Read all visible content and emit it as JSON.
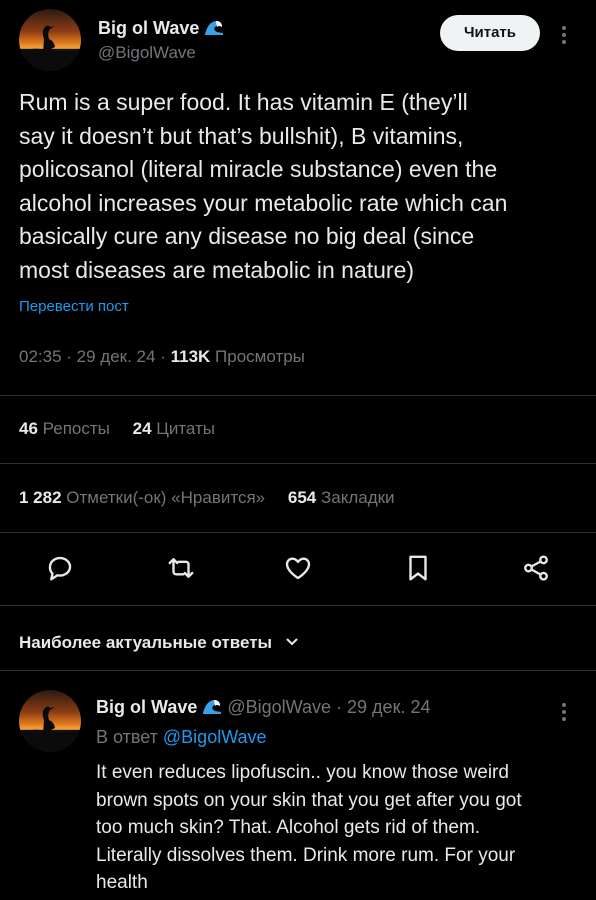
{
  "post": {
    "author_name": "Big ol Wave",
    "author_handle": "@BigolWave",
    "read_button": "Читать",
    "text": "Rum is a super food. It has vitamin E (they’ll\nsay it doesn’t but that’s bullshit), B vitamins,\npolicosanol (literal miracle substance) even the\nalcohol increases your metabolic rate which can\nbasically cure any disease no big deal (since\nmost diseases are metabolic in nature)",
    "translate_link": "Перевести пост",
    "time": "02:35",
    "date": "29 дек. 24",
    "views_count": "113K",
    "views_label": "Просмотры",
    "reposts_count": "46",
    "reposts_label": "Репосты",
    "quotes_count": "24",
    "quotes_label": "Цитаты",
    "likes_count": "1 282",
    "likes_label": "Отметки(-ок) «Нравится»",
    "bookmarks_count": "654",
    "bookmarks_label": "Закладки"
  },
  "actions": [
    "reply-icon",
    "repost-icon",
    "like-icon",
    "bookmark-icon",
    "share-icon"
  ],
  "replies": {
    "header": "Наиболее актуальные ответы",
    "items": [
      {
        "author_name": "Big ol Wave",
        "author_handle": "@BigolWave",
        "date": "29 дек. 24",
        "reply_to_prefix": "В ответ",
        "reply_to_handle": "@BigolWave",
        "text": "It even reduces lipofuscin.. you know those weird\nbrown spots on your skin that you get after you got\ntoo much skin? That. Alcohol gets rid of them.\nLiterally dissolves them. Drink more rum. For your\nhealth"
      }
    ]
  },
  "colors": {
    "background": "#000000",
    "text": "#e7e9ea",
    "muted": "#71767b",
    "link": "#1d9bf0",
    "divider": "#2f3336"
  }
}
